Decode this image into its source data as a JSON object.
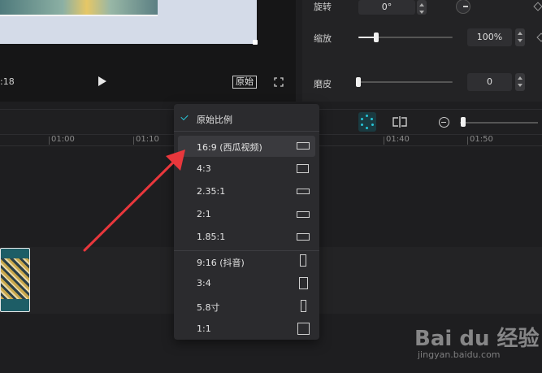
{
  "preview": {
    "time_code": ":18",
    "ratio_button": "原始"
  },
  "properties": {
    "rotate": {
      "label": "旋转",
      "value": "0°"
    },
    "scale": {
      "label": "缩放",
      "value": "100%",
      "level": 0.29
    },
    "smooth": {
      "label": "磨皮",
      "value": "0",
      "level": 0.0
    }
  },
  "ruler": {
    "ticks": [
      "01:00",
      "01:10",
      "01:40",
      "01:50"
    ]
  },
  "dropdown": {
    "items": [
      {
        "label": "原始比例",
        "checked": true,
        "icon": "check-icon"
      },
      {
        "label": "16:9 (西瓜视频)",
        "highlighted": true,
        "icon": "ratio-16-9-icon"
      },
      {
        "label": "4:3",
        "icon": "ratio-4-3-icon"
      },
      {
        "label": "2.35:1",
        "icon": "ratio-2-35-1-icon"
      },
      {
        "label": "2:1",
        "icon": "ratio-2-1-icon"
      },
      {
        "label": "1.85:1",
        "icon": "ratio-1-85-1-icon"
      },
      {
        "label": "9:16 (抖音)",
        "icon": "ratio-9-16-icon"
      },
      {
        "label": "3:4",
        "icon": "ratio-3-4-icon"
      },
      {
        "label": "5.8寸",
        "icon": "ratio-5-8-icon"
      },
      {
        "label": "1:1",
        "icon": "ratio-1-1-icon"
      }
    ]
  },
  "watermark": {
    "text": "Bai du 经验",
    "url": "jingyan.baidu.com"
  },
  "colors": {
    "accent": "#27c4d6",
    "arrow": "#e8373c"
  }
}
